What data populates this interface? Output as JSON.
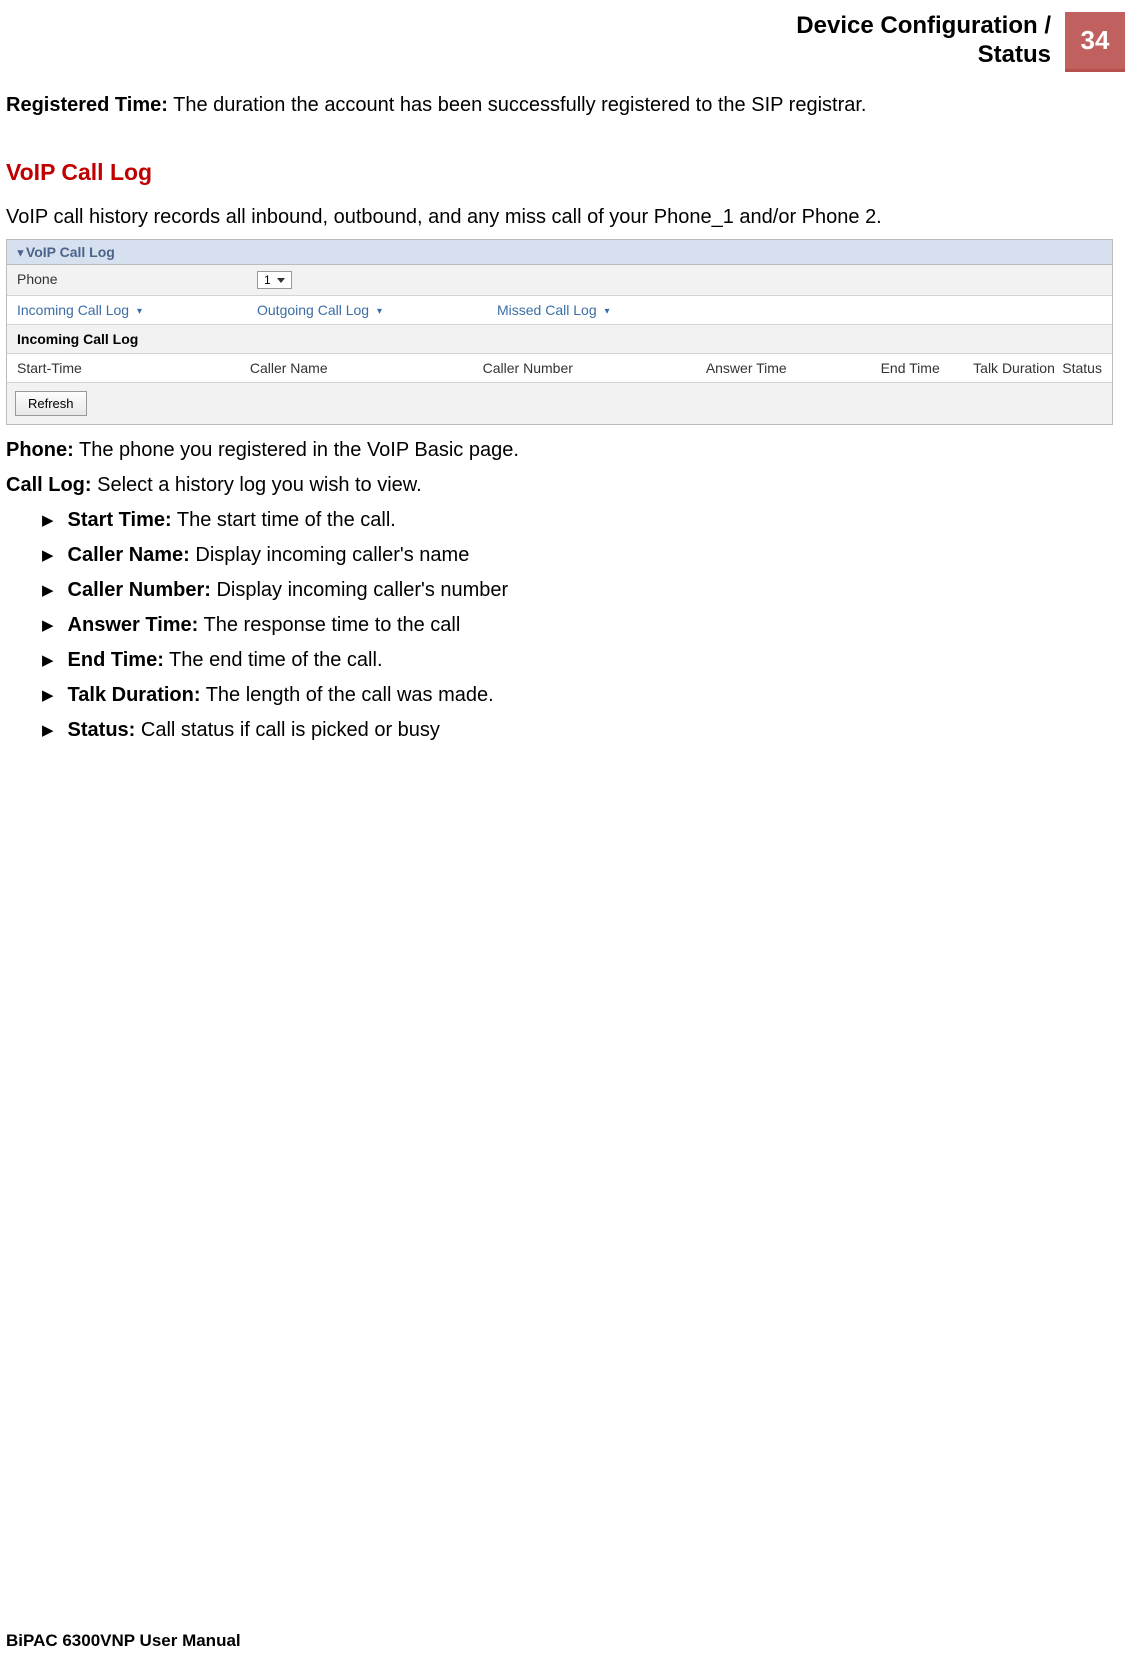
{
  "header": {
    "title_line1": "Device Configuration /",
    "title_line2": "Status",
    "page_number": "34"
  },
  "registered_time": {
    "label": "Registered Time:",
    "desc": " The duration the account has been successfully registered to the SIP registrar."
  },
  "section_title": "VoIP Call Log",
  "voip_intro": "VoIP call history records all inbound, outbound, and any miss call of your Phone_1 and/or Phone 2.",
  "ui": {
    "panel_title": "VoIP Call Log",
    "phone_label": "Phone",
    "phone_value": "1",
    "tabs": {
      "incoming": "Incoming Call Log",
      "outgoing": "Outgoing Call Log",
      "missed": "Missed Call Log"
    },
    "subheader": "Incoming Call Log",
    "cols": {
      "start_time": "Start-Time",
      "caller_name": "Caller Name",
      "caller_number": "Caller Number",
      "answer_time": "Answer Time",
      "end_time": "End Time",
      "talk_duration": "Talk Duration",
      "status": "Status"
    },
    "refresh": "Refresh"
  },
  "phone_field": {
    "label": "Phone:",
    "desc": " The phone you registered in the VoIP Basic page."
  },
  "call_log_field": {
    "label": "Call Log:",
    "desc": " Select a history log you wish to view."
  },
  "bullets": [
    {
      "label": "Start Time:",
      "desc": " The start time of the call."
    },
    {
      "label": "Caller Name:",
      "desc": " Display incoming caller's name"
    },
    {
      "label": "Caller Number:",
      "desc": " Display incoming caller's number"
    },
    {
      "label": "Answer Time:",
      "desc": " The response time to the call"
    },
    {
      "label": "End Time:",
      "desc": " The end time of the call."
    },
    {
      "label": "Talk Duration:",
      "desc": " The length of the call was made."
    },
    {
      "label": "Status:",
      "desc": " Call status if call is picked or busy"
    }
  ],
  "footer": "BiPAC 6300VNP User Manual"
}
